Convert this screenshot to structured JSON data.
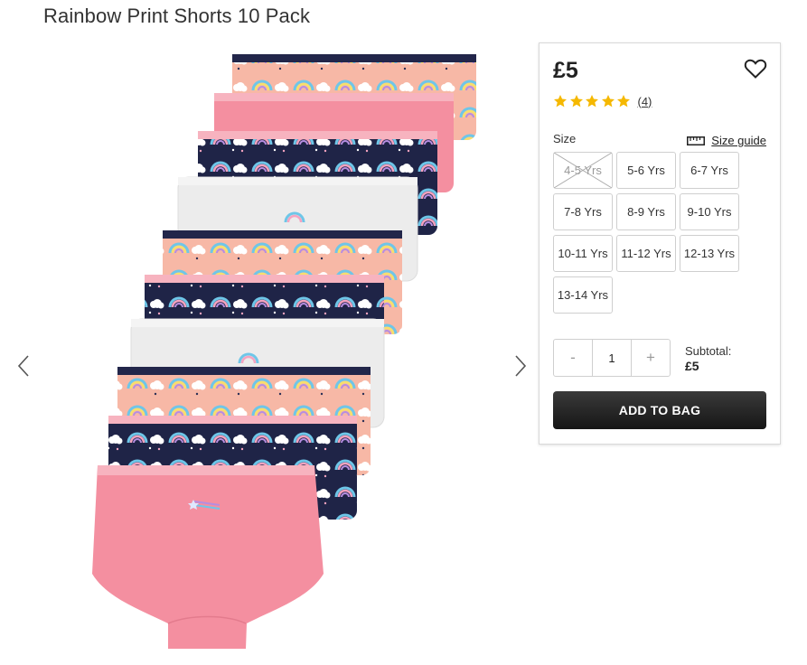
{
  "product": {
    "title": "Rainbow Print Shorts 10 Pack",
    "price": "£5",
    "rating": 5,
    "rating_count": "(4)",
    "image_alt": "Ten pairs of rainbow print shorts in pink, navy and white"
  },
  "size": {
    "label": "Size",
    "guide_label": "Size guide",
    "options": [
      {
        "label": "4-5 Yrs",
        "available": false
      },
      {
        "label": "5-6 Yrs",
        "available": true
      },
      {
        "label": "6-7 Yrs",
        "available": true
      },
      {
        "label": "7-8 Yrs",
        "available": true
      },
      {
        "label": "8-9 Yrs",
        "available": true
      },
      {
        "label": "9-10 Yrs",
        "available": true
      },
      {
        "label": "10-11 Yrs",
        "available": true
      },
      {
        "label": "11-12 Yrs",
        "available": true
      },
      {
        "label": "12-13 Yrs",
        "available": true
      },
      {
        "label": "13-14 Yrs",
        "available": true
      }
    ]
  },
  "quantity": {
    "decrement": "-",
    "value": "1",
    "increment": "+"
  },
  "subtotal": {
    "label": "Subtotal:",
    "amount": "£5"
  },
  "add_to_bag": "ADD TO BAG",
  "icons": {
    "wishlist": "heart-outline-icon",
    "size_guide": "ruler-icon",
    "prev": "chevron-left-icon",
    "next": "chevron-right-icon",
    "star": "star-icon"
  },
  "colors": {
    "star": "#f5b800",
    "button": "#222222",
    "pink": "#f48fa0",
    "navy": "#1f2447",
    "peach": "#f7b8a6",
    "white_short": "#eeeeee"
  }
}
